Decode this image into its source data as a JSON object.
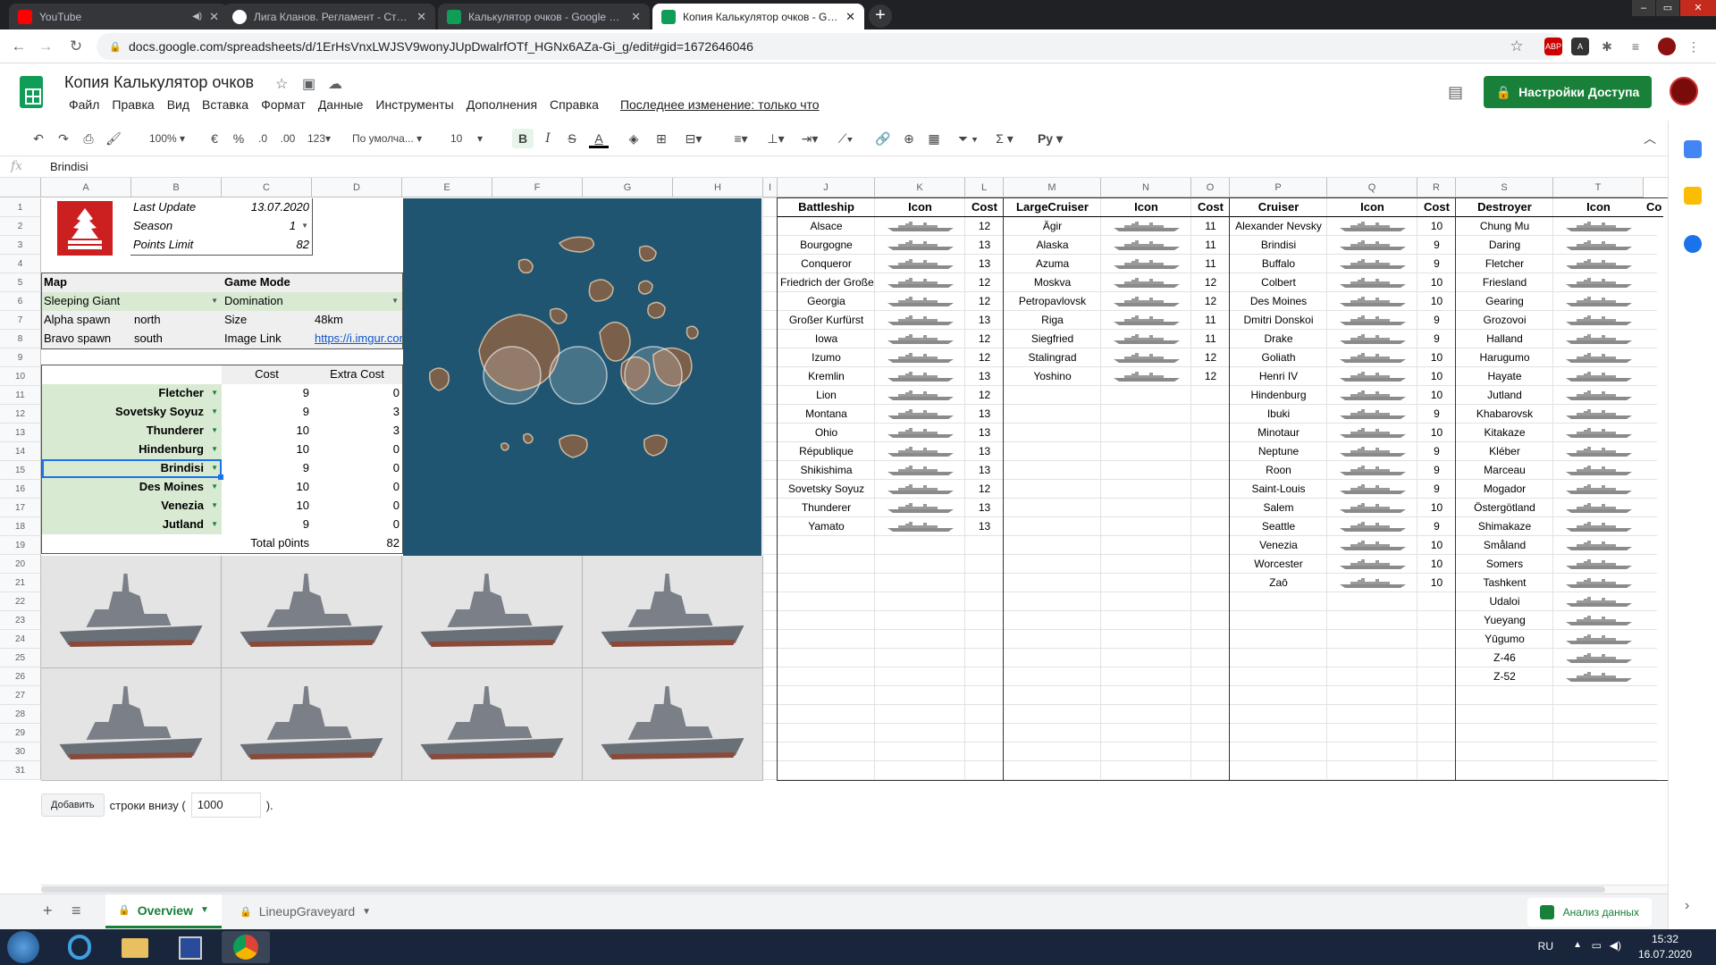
{
  "browser": {
    "tabs": [
      {
        "title": "YouTube",
        "fav_color": "#ff0000"
      },
      {
        "title": "Лига Кланов. Регламент - Стран",
        "fav_color": "#ffffff"
      },
      {
        "title": "Калькулятор очков - Google Таб",
        "fav_color": "#0f9d58"
      },
      {
        "title": "Копия Калькулятор очков - Goo",
        "fav_color": "#0f9d58"
      }
    ],
    "url": "docs.google.com/spreadsheets/d/1ErHsVnxLWJSV9wonyJUpDwalrfOTf_HGNx6AZa-Gi_g/edit#gid=1672646046"
  },
  "doc": {
    "title": "Копия Калькулятор очков",
    "menu": [
      "Файл",
      "Правка",
      "Вид",
      "Вставка",
      "Формат",
      "Данные",
      "Инструменты",
      "Дополнения",
      "Справка"
    ],
    "last_edit": "Последнее изменение: только что",
    "share_label": "Настройки Доступа"
  },
  "toolbar": {
    "zoom": "100%",
    "currency": "€",
    "percent": "%",
    "dec_less": ".0",
    "dec_more": ".00",
    "format": "123",
    "font": "По умолча...",
    "size": "10",
    "bold": "B",
    "italic": "I",
    "strike": "S",
    "text_color": "A",
    "lang": "Ру"
  },
  "formula": {
    "label": "fx",
    "value": "Brindisi"
  },
  "columns": [
    "A",
    "B",
    "C",
    "D",
    "E",
    "F",
    "G",
    "H",
    "I",
    "J",
    "K",
    "L",
    "M",
    "N",
    "O",
    "P",
    "Q",
    "R",
    "S",
    "T"
  ],
  "left_panel": {
    "last_update_label": "Last Update",
    "last_update": "13.07.2020",
    "season_label": "Season",
    "season": "1",
    "points_limit_label": "Points Limit",
    "points_limit": "82",
    "map_label": "Map",
    "map": "Sleeping Giant",
    "game_mode_label": "Game Mode",
    "game_mode": "Domination",
    "alpha_label": "Alpha spawn",
    "alpha": "north",
    "size_label": "Size",
    "size": "48km",
    "bravo_label": "Bravo spawn",
    "bravo": "south",
    "image_link_label": "Image Link",
    "image_link": "https://i.imgur.com",
    "cost_header": "Cost",
    "extra_cost_header": "Extra Cost",
    "lineup": [
      {
        "ship": "Fletcher",
        "cost": "9",
        "extra": "0"
      },
      {
        "ship": "Sovetsky Soyuz",
        "cost": "9",
        "extra": "3"
      },
      {
        "ship": "Thunderer",
        "cost": "10",
        "extra": "3"
      },
      {
        "ship": "Hindenburg",
        "cost": "10",
        "extra": "0"
      },
      {
        "ship": "Brindisi",
        "cost": "9",
        "extra": "0"
      },
      {
        "ship": "Des Moines",
        "cost": "10",
        "extra": "0"
      },
      {
        "ship": "Venezia",
        "cost": "10",
        "extra": "0"
      },
      {
        "ship": "Jutland",
        "cost": "9",
        "extra": "0"
      }
    ],
    "total_label": "Total p0ints",
    "total": "82"
  },
  "tables": {
    "battleship": {
      "header": "Battleship",
      "icon_header": "Icon",
      "cost_header": "Cost",
      "rows": [
        {
          "name": "Alsace",
          "cost": "12"
        },
        {
          "name": "Bourgogne",
          "cost": "13"
        },
        {
          "name": "Conqueror",
          "cost": "13"
        },
        {
          "name": "Friedrich der Große",
          "cost": "12"
        },
        {
          "name": "Georgia",
          "cost": "12"
        },
        {
          "name": "Großer Kurfürst",
          "cost": "13"
        },
        {
          "name": "Iowa",
          "cost": "12"
        },
        {
          "name": "Izumo",
          "cost": "12"
        },
        {
          "name": "Kremlin",
          "cost": "13"
        },
        {
          "name": "Lion",
          "cost": "12"
        },
        {
          "name": "Montana",
          "cost": "13"
        },
        {
          "name": "Ohio",
          "cost": "13"
        },
        {
          "name": "République",
          "cost": "13"
        },
        {
          "name": "Shikishima",
          "cost": "13"
        },
        {
          "name": "Sovetsky Soyuz",
          "cost": "12"
        },
        {
          "name": "Thunderer",
          "cost": "13"
        },
        {
          "name": "Yamato",
          "cost": "13"
        }
      ]
    },
    "large_cruiser": {
      "header": "LargeCruiser",
      "icon_header": "Icon",
      "cost_header": "Cost",
      "rows": [
        {
          "name": "Ägir",
          "cost": "11"
        },
        {
          "name": "Alaska",
          "cost": "11"
        },
        {
          "name": "Azuma",
          "cost": "11"
        },
        {
          "name": "Moskva",
          "cost": "12"
        },
        {
          "name": "Petropavlovsk",
          "cost": "12"
        },
        {
          "name": "Riga",
          "cost": "11"
        },
        {
          "name": "Siegfried",
          "cost": "11"
        },
        {
          "name": "Stalingrad",
          "cost": "12"
        },
        {
          "name": "Yoshino",
          "cost": "12"
        }
      ]
    },
    "cruiser": {
      "header": "Cruiser",
      "icon_header": "Icon",
      "cost_header": "Cost",
      "rows": [
        {
          "name": "Alexander Nevsky",
          "cost": "10"
        },
        {
          "name": "Brindisi",
          "cost": "9"
        },
        {
          "name": "Buffalo",
          "cost": "9"
        },
        {
          "name": "Colbert",
          "cost": "10"
        },
        {
          "name": "Des Moines",
          "cost": "10"
        },
        {
          "name": "Dmitri Donskoi",
          "cost": "9"
        },
        {
          "name": "Drake",
          "cost": "9"
        },
        {
          "name": "Goliath",
          "cost": "10"
        },
        {
          "name": "Henri IV",
          "cost": "10"
        },
        {
          "name": "Hindenburg",
          "cost": "10"
        },
        {
          "name": "Ibuki",
          "cost": "9"
        },
        {
          "name": "Minotaur",
          "cost": "10"
        },
        {
          "name": "Neptune",
          "cost": "9"
        },
        {
          "name": "Roon",
          "cost": "9"
        },
        {
          "name": "Saint-Louis",
          "cost": "9"
        },
        {
          "name": "Salem",
          "cost": "10"
        },
        {
          "name": "Seattle",
          "cost": "9"
        },
        {
          "name": "Venezia",
          "cost": "10"
        },
        {
          "name": "Worcester",
          "cost": "10"
        },
        {
          "name": "Zaō",
          "cost": "10"
        }
      ]
    },
    "destroyer": {
      "header": "Destroyer",
      "icon_header": "Icon",
      "cost_header": "Co",
      "rows": [
        {
          "name": "Chung Mu"
        },
        {
          "name": "Daring"
        },
        {
          "name": "Fletcher"
        },
        {
          "name": "Friesland"
        },
        {
          "name": "Gearing"
        },
        {
          "name": "Grozovoi"
        },
        {
          "name": "Halland"
        },
        {
          "name": "Harugumo"
        },
        {
          "name": "Hayate"
        },
        {
          "name": "Jutland"
        },
        {
          "name": "Khabarovsk"
        },
        {
          "name": "Kitakaze"
        },
        {
          "name": "Kléber"
        },
        {
          "name": "Marceau"
        },
        {
          "name": "Mogador"
        },
        {
          "name": "Östergötland"
        },
        {
          "name": "Shimakaze"
        },
        {
          "name": "Småland"
        },
        {
          "name": "Somers"
        },
        {
          "name": "Tashkent"
        },
        {
          "name": "Udaloi"
        },
        {
          "name": "Yueyang"
        },
        {
          "name": "Yūgumo"
        },
        {
          "name": "Z-46"
        },
        {
          "name": "Z-52"
        }
      ]
    }
  },
  "add_rows": {
    "button": "Добавить",
    "text": "строки внизу (",
    "value": "1000",
    "suffix": ")."
  },
  "sheets": [
    {
      "name": "Overview"
    },
    {
      "name": "LineupGraveyard"
    }
  ],
  "explore_label": "Анализ данных",
  "taskbar": {
    "lang": "RU",
    "time": "15:32",
    "date": "16.07.2020"
  },
  "colors": {
    "green": "#188038",
    "sheet_green": "#d9ead3",
    "map_water": "#1f5570"
  }
}
